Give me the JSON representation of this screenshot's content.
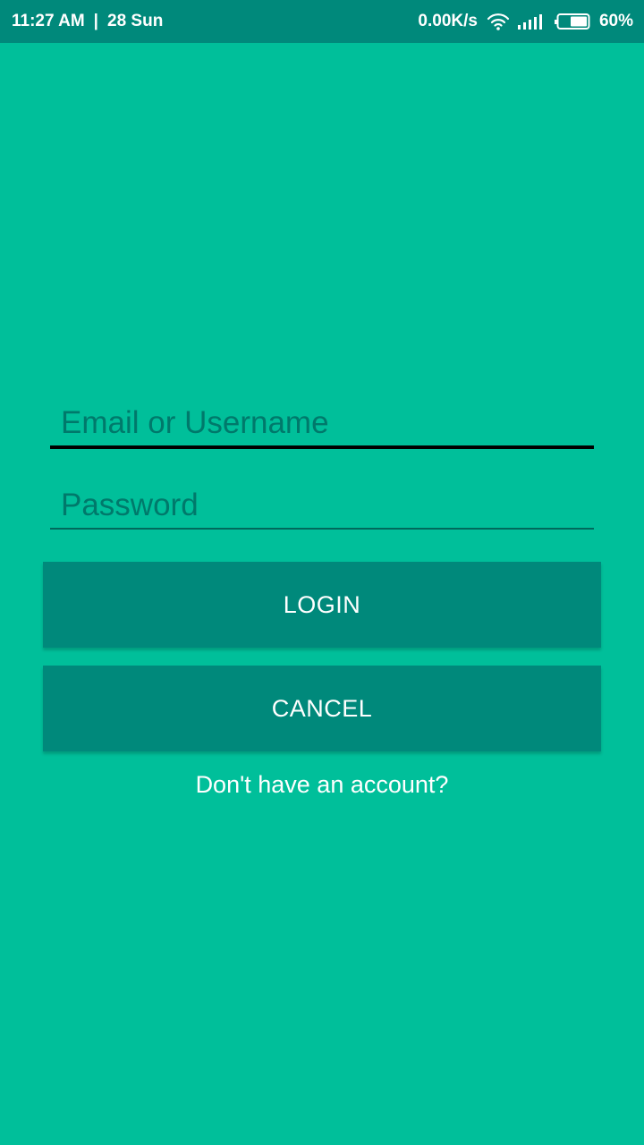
{
  "status_bar": {
    "time": "11:27 AM",
    "separator": "|",
    "date": "28 Sun",
    "network_speed": "0.00K/s",
    "battery_percent": "60%",
    "battery_level": 0.6,
    "wifi_icon": "wifi-icon",
    "signal_icon": "cell-signal-icon",
    "battery_icon": "battery-icon"
  },
  "login_form": {
    "email_placeholder": "Email or Username",
    "email_value": "",
    "password_placeholder": "Password",
    "password_value": "",
    "login_label": "LOGIN",
    "cancel_label": "CANCEL",
    "signup_prompt": "Don't have an account?"
  },
  "colors": {
    "background": "#00BF9A",
    "status_bar": "#00897B",
    "button": "#00897B",
    "text": "#FFFFFF",
    "placeholder": "#00796B"
  }
}
